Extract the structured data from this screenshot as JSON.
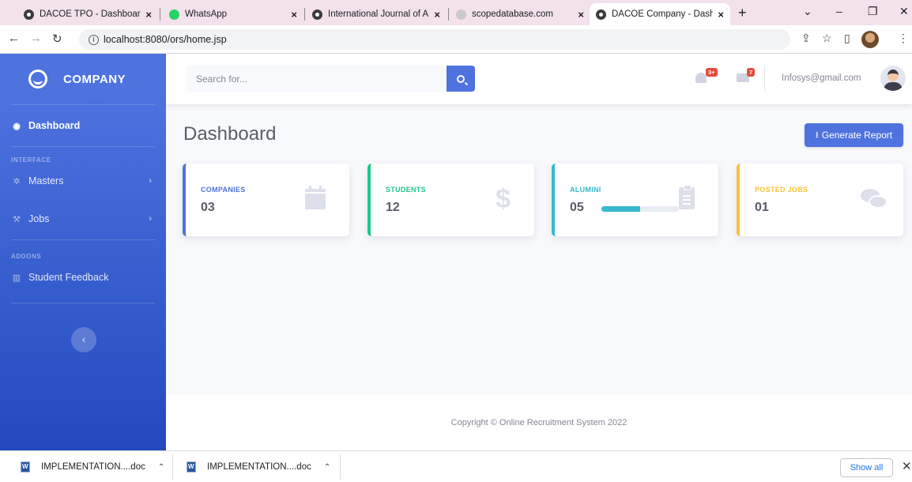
{
  "browser": {
    "tabs": [
      {
        "title": "DACOE TPO - Dashboard",
        "favicon": "chrome-icon",
        "active": false
      },
      {
        "title": "WhatsApp",
        "favicon": "whatsapp-icon",
        "active": false
      },
      {
        "title": "International Journal of A",
        "favicon": "chrome-icon",
        "active": false
      },
      {
        "title": "scopedatabase.com",
        "favicon": "globe-icon",
        "active": false
      },
      {
        "title": "DACOE Company - Dashb",
        "favicon": "chrome-icon",
        "active": true
      }
    ],
    "close_glyph": "×",
    "new_tab": "+",
    "url": "localhost:8080/ors/home.jsp"
  },
  "sidebar": {
    "brand": "COMPANY",
    "dashboard": "Dashboard",
    "heading_interface": "INTERFACE",
    "masters": "Masters",
    "jobs": "Jobs",
    "heading_addons": "ADDONS",
    "feedback": "Student Feedback",
    "toggle_glyph": "‹"
  },
  "topbar": {
    "search_placeholder": "Search for...",
    "alerts_badge": "3+",
    "messages_badge": "7",
    "user_email": "Infosys@gmail.com"
  },
  "main": {
    "title": "Dashboard",
    "generate_report": "Generate Report",
    "cards": [
      {
        "label": "COMPANIES",
        "value": "03",
        "icon": "calendar-icon",
        "color": "#4e73df"
      },
      {
        "label": "STUDENTS",
        "value": "12",
        "icon": "dollar-icon",
        "color": "#1cc88a"
      },
      {
        "label": "ALUMINI",
        "value": "05",
        "icon": "clipboard-icon",
        "color": "#36b9cc",
        "progress": 0.5
      },
      {
        "label": "POSTED JOBS",
        "value": "01",
        "icon": "comments-icon",
        "color": "#f6c23e"
      }
    ]
  },
  "footer": {
    "copyright": "Copyright © Online Recruitment System 2022"
  },
  "downloads": {
    "items": [
      {
        "name": "IMPLEMENTATION....doc"
      },
      {
        "name": "IMPLEMENTATION....doc"
      }
    ],
    "show_all": "Show all"
  },
  "colors": {
    "primary": "#4e73df",
    "success": "#1cc88a",
    "info": "#36b9cc",
    "warning": "#f6c23e",
    "danger": "#e74a3b"
  }
}
